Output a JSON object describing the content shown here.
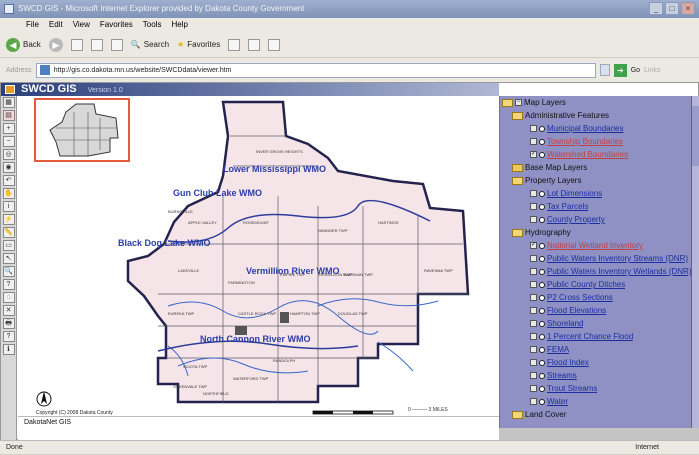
{
  "window": {
    "title": "SWCD GIS - Microsoft Internet Explorer provided by Dakota County Government"
  },
  "menu": [
    "File",
    "Edit",
    "View",
    "Favorites",
    "Tools",
    "Help"
  ],
  "toolbar": {
    "back": "Back",
    "search": "Search",
    "favorites": "Favorites"
  },
  "address": {
    "label": "Address",
    "url": "http://gis.co.dakota.mn.us/website/SWCDdata/viewer.htm",
    "go": "Go",
    "links": "Links"
  },
  "app": {
    "title": "SWCD GIS",
    "version": "Version 1.0",
    "copyright": "Copyright (C) 2008 Dakota County",
    "footer": "DakotaNet GIS"
  },
  "map": {
    "labels": {
      "lower_mississippi": "Lower Mississippi WMO",
      "gun_club": "Gun Club Lake WMO",
      "black_dog": "Black Dog Lake WMO",
      "vermillion": "Vermillion River WMO",
      "north_cannon": "North Cannon River WMO"
    },
    "places": [
      "BURNSVILLE",
      "APPLE VALLEY",
      "ROSEMOUNT",
      "INVER GROVE HEIGHTS",
      "LAKEVILLE",
      "FARMINGTON",
      "HASTINGS",
      "MARSHAN TWP",
      "RAVENNA TWP",
      "EUREKA TWP",
      "NININGER TWP",
      "SCIOTA TWP",
      "WATERFORD TWP",
      "GREENVALE TWP",
      "CASTLE ROCK TWP",
      "HAMPTON TWP",
      "DOUGLAS TWP",
      "EMPIRE TWP",
      "VERMILLION TWP",
      "NORTHFIELD",
      "RANDOLPH"
    ]
  },
  "layers": {
    "title": "Map Layers",
    "items": [
      {
        "label": "Administrative Features",
        "kind": "group",
        "open": true
      },
      {
        "label": "Municipal Boundaries",
        "kind": "layer",
        "checked": false,
        "color": "#1a2ea0"
      },
      {
        "label": "Township Boundaries",
        "kind": "layer",
        "checked": false,
        "color": "#c24040"
      },
      {
        "label": "Watershed Boundaries",
        "kind": "layer",
        "checked": true,
        "color": "#c24040"
      },
      {
        "label": "Base Map Layers",
        "kind": "group",
        "open": false
      },
      {
        "label": "Property Layers",
        "kind": "group",
        "open": true
      },
      {
        "label": "Lot Dimensions",
        "kind": "layer",
        "checked": false,
        "color": "#1a2ea0"
      },
      {
        "label": "Tax Parcels",
        "kind": "layer",
        "checked": false,
        "color": "#1a2ea0"
      },
      {
        "label": "County Property",
        "kind": "layer",
        "checked": false,
        "color": "#1a2ea0"
      },
      {
        "label": "Hydrography",
        "kind": "group",
        "open": true
      },
      {
        "label": "National Wetland Inventory",
        "kind": "layer",
        "checked": true,
        "color": "#c24040"
      },
      {
        "label": "Public Waters Inventory Streams (DNR)",
        "kind": "layer",
        "checked": false,
        "color": "#1a2ea0"
      },
      {
        "label": "Public Waters Inventory Wetlands (DNR)",
        "kind": "layer",
        "checked": false,
        "color": "#1a2ea0"
      },
      {
        "label": "Public County Ditches",
        "kind": "layer",
        "checked": false,
        "color": "#1a2ea0"
      },
      {
        "label": "P2 Cross Sections",
        "kind": "layer",
        "checked": false,
        "color": "#1a2ea0"
      },
      {
        "label": "Flood Elevations",
        "kind": "layer",
        "checked": false,
        "color": "#1a2ea0"
      },
      {
        "label": "Shoreland",
        "kind": "layer",
        "checked": false,
        "color": "#1a2ea0"
      },
      {
        "label": "1 Percent Chance Flood",
        "kind": "layer",
        "checked": false,
        "color": "#1a2ea0"
      },
      {
        "label": "FEMA",
        "kind": "layer",
        "checked": false,
        "color": "#1a2ea0"
      },
      {
        "label": "Flood Index",
        "kind": "layer",
        "checked": false,
        "color": "#1a2ea0"
      },
      {
        "label": "Streams",
        "kind": "layer",
        "checked": false,
        "color": "#1a2ea0"
      },
      {
        "label": "Trout Streams",
        "kind": "layer",
        "checked": false,
        "color": "#1a2ea0"
      },
      {
        "label": "Water",
        "kind": "layer",
        "checked": false,
        "color": "#1a2ea0"
      },
      {
        "label": "Land Cover",
        "kind": "group",
        "open": true
      }
    ]
  },
  "scalebar": {
    "text": "0 ——— 3 MILES"
  },
  "status": {
    "text": "Done",
    "zone": "Internet"
  }
}
